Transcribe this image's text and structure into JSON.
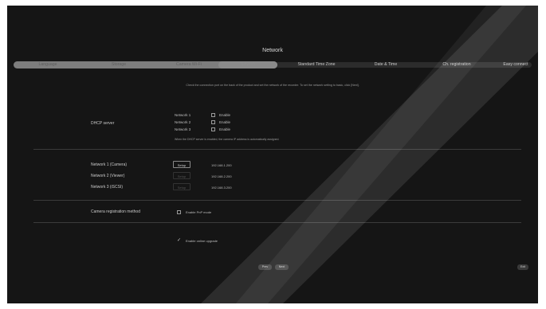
{
  "window": {
    "title": "Network"
  },
  "steps": [
    {
      "label": "Language",
      "state": "done"
    },
    {
      "label": "Storage",
      "state": "done"
    },
    {
      "label": "Camera Wi-Fi",
      "state": "done"
    },
    {
      "label": "Network",
      "state": "current"
    },
    {
      "label": "Standard Time Zone",
      "state": "todo"
    },
    {
      "label": "Date & Time",
      "state": "todo"
    },
    {
      "label": "Ch. registration",
      "state": "todo"
    },
    {
      "label": "Easy connect",
      "state": "todo"
    }
  ],
  "hint": "Check the connection port on the back of the product and set the network of the recorder. To set the network setting to basic, click [Next].",
  "dhcp": {
    "label": "DHCP server",
    "rows": [
      {
        "name": "Network 1",
        "option": "Enable"
      },
      {
        "name": "Network 2",
        "option": "Enable"
      },
      {
        "name": "Network 3",
        "option": "Enable"
      }
    ],
    "note": "When the DHCP server is enabled, the camera IP address is automatically assigned."
  },
  "networks": [
    {
      "name": "Network 1 (Camera)",
      "button": "Setup",
      "ip": "192.168.1.200",
      "enabled": true
    },
    {
      "name": "Network 2 (Viewer)",
      "button": "Setup",
      "ip": "192.168.2.200",
      "enabled": false
    },
    {
      "name": "Network 3 (iSCSI)",
      "button": "Setup",
      "ip": "192.168.3.200",
      "enabled": false
    }
  ],
  "camera_reg": {
    "label": "Camera registration method",
    "option": "Enable PnP mode"
  },
  "upgrade": {
    "label": "Enable online upgrade"
  },
  "nav": {
    "prev": "Prev",
    "next": "Next",
    "exit": "Exit"
  }
}
